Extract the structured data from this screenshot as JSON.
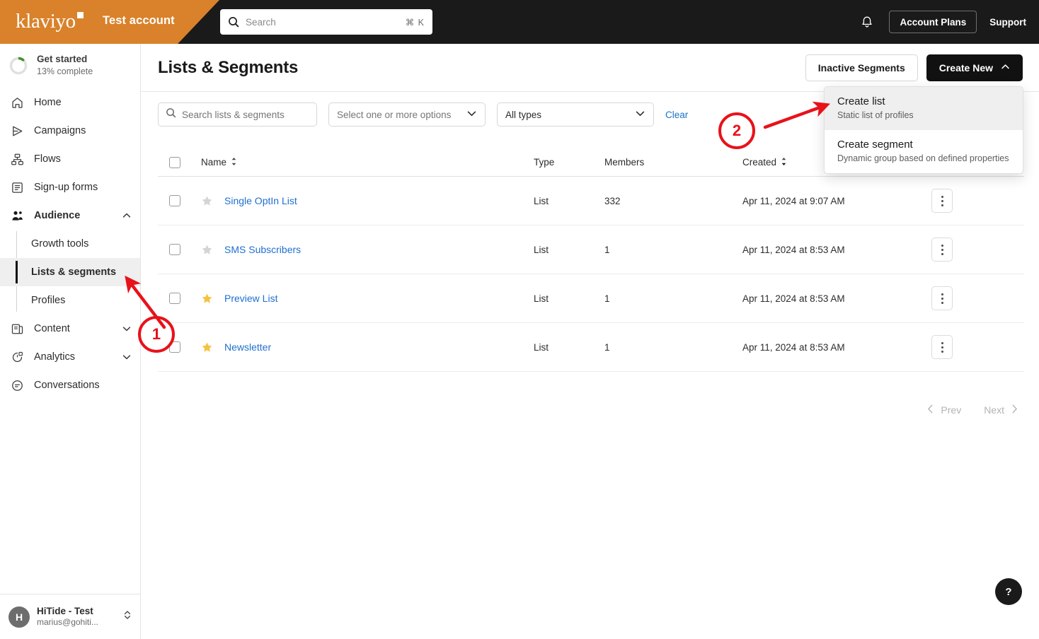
{
  "topbar": {
    "logo_text": "klaviyo",
    "account_name": "Test account",
    "search_placeholder": "Search",
    "search_value": "",
    "search_shortcut": "⌘ K",
    "bell_icon": "bell-icon",
    "account_plans_label": "Account Plans",
    "support_label": "Support"
  },
  "sidebar": {
    "get_started": {
      "title": "Get started",
      "subtitle": "13% complete",
      "percent": 13
    },
    "items": [
      {
        "label": "Home",
        "icon": "home-icon"
      },
      {
        "label": "Campaigns",
        "icon": "send-icon"
      },
      {
        "label": "Flows",
        "icon": "flows-icon"
      },
      {
        "label": "Sign-up forms",
        "icon": "form-icon"
      },
      {
        "label": "Audience",
        "icon": "audience-icon",
        "expanded": true
      },
      {
        "label": "Content",
        "icon": "content-icon",
        "expanded": false
      },
      {
        "label": "Analytics",
        "icon": "analytics-icon",
        "expanded": false
      },
      {
        "label": "Conversations",
        "icon": "conversations-icon"
      }
    ],
    "audience_subitems": [
      {
        "label": "Growth tools",
        "active": false
      },
      {
        "label": "Lists & segments",
        "active": true
      },
      {
        "label": "Profiles",
        "active": false
      }
    ],
    "user": {
      "initial": "H",
      "name": "HiTide - Test",
      "email": "marius@gohiti...",
      "switch_icon": "chevron-up-down-icon"
    }
  },
  "page": {
    "title": "Lists & Segments",
    "inactive_segments_label": "Inactive Segments",
    "create_new_label": "Create New",
    "create_new_chevron": "chevron-up-icon"
  },
  "dropdown": {
    "items": [
      {
        "title": "Create list",
        "subtitle": "Static list of profiles",
        "hovered": true
      },
      {
        "title": "Create segment",
        "subtitle": "Dynamic group based on defined properties",
        "hovered": false
      }
    ]
  },
  "filters": {
    "search_placeholder": "Search lists & segments",
    "search_value": "",
    "tags_placeholder": "Select one or more options",
    "type_value": "All types",
    "clear_label": "Clear"
  },
  "table": {
    "columns": {
      "name": "Name",
      "type": "Type",
      "members": "Members",
      "created": "Created"
    },
    "sort_icon": "sort-arrows-icon",
    "rows": [
      {
        "starred": false,
        "name": "Single OptIn List",
        "type": "List",
        "members": "332",
        "created": "Apr 11, 2024 at 9:07 AM"
      },
      {
        "starred": false,
        "name": "SMS Subscribers",
        "type": "List",
        "members": "1",
        "created": "Apr 11, 2024 at 8:53 AM"
      },
      {
        "starred": true,
        "name": "Preview List",
        "type": "List",
        "members": "1",
        "created": "Apr 11, 2024 at 8:53 AM"
      },
      {
        "starred": true,
        "name": "Newsletter",
        "type": "List",
        "members": "1",
        "created": "Apr 11, 2024 at 8:53 AM"
      }
    ]
  },
  "pagination": {
    "prev_label": "Prev",
    "next_label": "Next"
  },
  "help": {
    "label": "?"
  },
  "annotations": [
    {
      "number": "1"
    },
    {
      "number": "2"
    }
  ],
  "colors": {
    "brand_orange": "#D9822B",
    "topbar_dark": "#1a1a1a",
    "link_blue": "#1f6fd0",
    "star_gold": "#F5C243",
    "annotation_red": "#e8121a",
    "progress_green": "#3f8f29"
  }
}
